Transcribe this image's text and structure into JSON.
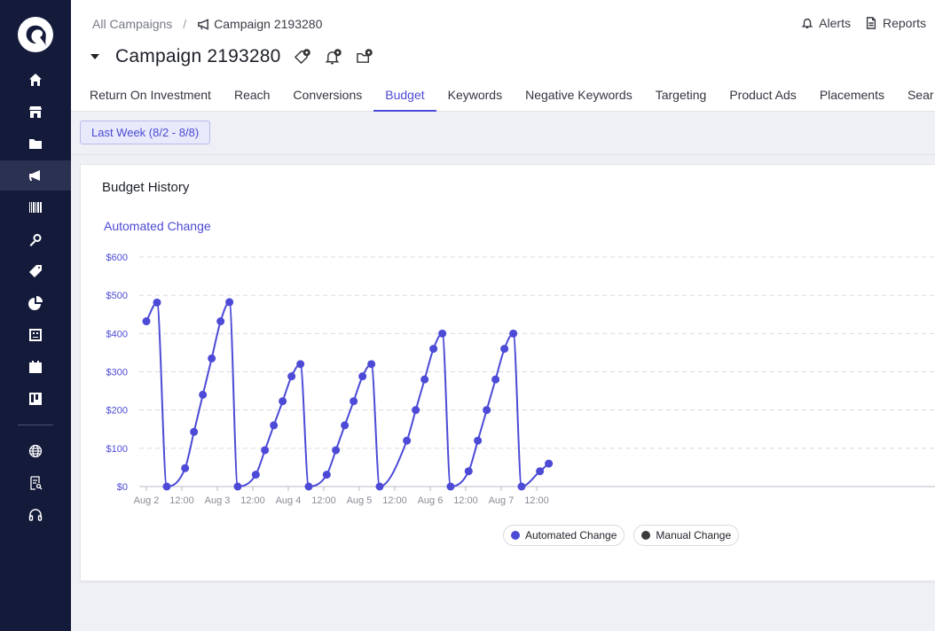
{
  "sidebar": {
    "items": [
      {
        "icon": "home-icon",
        "name": "sidebar-item-home"
      },
      {
        "icon": "store-icon",
        "name": "sidebar-item-store"
      },
      {
        "icon": "folder-icon",
        "name": "sidebar-item-folder"
      },
      {
        "icon": "megaphone-icon",
        "name": "sidebar-item-campaigns",
        "active": true
      },
      {
        "icon": "barcode-icon",
        "name": "sidebar-item-products"
      },
      {
        "icon": "search-icon",
        "name": "sidebar-item-search"
      },
      {
        "icon": "tag-icon",
        "name": "sidebar-item-tags"
      },
      {
        "icon": "pie-chart-icon",
        "name": "sidebar-item-analytics"
      },
      {
        "icon": "dashboard-icon",
        "name": "sidebar-item-dashboard"
      },
      {
        "icon": "calendar-icon",
        "name": "sidebar-item-calendar"
      },
      {
        "icon": "kanban-icon",
        "name": "sidebar-item-board"
      },
      {
        "icon": "globe-icon",
        "name": "sidebar-item-globe"
      },
      {
        "icon": "report-icon",
        "name": "sidebar-item-reports"
      },
      {
        "icon": "headset-icon",
        "name": "sidebar-item-support"
      }
    ]
  },
  "breadcrumb": {
    "root": "All Campaigns",
    "separator": "/",
    "current": "Campaign 2193280"
  },
  "header": {
    "title": "Campaign 2193280",
    "alerts_label": "Alerts",
    "reports_label": "Reports"
  },
  "tabs": [
    {
      "label": "Return On Investment"
    },
    {
      "label": "Reach"
    },
    {
      "label": "Conversions"
    },
    {
      "label": "Budget",
      "active": true
    },
    {
      "label": "Keywords"
    },
    {
      "label": "Negative Keywords"
    },
    {
      "label": "Targeting"
    },
    {
      "label": "Product Ads"
    },
    {
      "label": "Placements"
    },
    {
      "label": "Sear"
    }
  ],
  "daterange": {
    "label": "Last Week (8/2 - 8/8)"
  },
  "card": {
    "title": "Budget History"
  },
  "colors": {
    "accent": "#4c4ad6",
    "manual": "#3a3a3a"
  },
  "chart_data": {
    "type": "line",
    "title": "Automated Change",
    "ylim": [
      0,
      600
    ],
    "y_ticks": [
      "$0",
      "$100",
      "$200",
      "$300",
      "$400",
      "$500",
      "$600"
    ],
    "x_ticks": [
      "Aug 2",
      "12:00",
      "Aug 3",
      "12:00",
      "Aug 4",
      "12:00",
      "Aug 5",
      "12:00",
      "Aug 6",
      "12:00",
      "Aug 7",
      "12:00"
    ],
    "x_unit": "hours since Aug 2 00:00",
    "legend": [
      {
        "name": "Automated Change",
        "color": "#4c4ad6"
      },
      {
        "name": "Manual Change",
        "color": "#3a3a3a"
      }
    ],
    "series": [
      {
        "name": "Automated Change",
        "color": "#4c4ad6",
        "x": [
          0,
          3.6,
          6.9,
          13.1,
          16.1,
          19.1,
          22.1,
          25.1,
          28.1,
          30.9,
          37.0,
          40.1,
          43.1,
          46.1,
          49.1,
          52.1,
          54.9,
          61.0,
          64.1,
          67.1,
          70.1,
          73.1,
          76.1,
          78.9,
          88.1,
          91.1,
          94.1,
          97.1,
          100.1,
          102.9,
          109.0,
          112.1,
          115.1,
          118.1,
          121.1,
          124.1,
          126.9,
          133.1,
          136.1
        ],
        "y": [
          432,
          481,
          0,
          48,
          143,
          240,
          335,
          432,
          482,
          0,
          31,
          95,
          160,
          223,
          288,
          320,
          0,
          31,
          95,
          160,
          223,
          288,
          320,
          0,
          120,
          200,
          280,
          360,
          400,
          0,
          40,
          120,
          200,
          280,
          360,
          400,
          0,
          40,
          60
        ]
      }
    ]
  }
}
